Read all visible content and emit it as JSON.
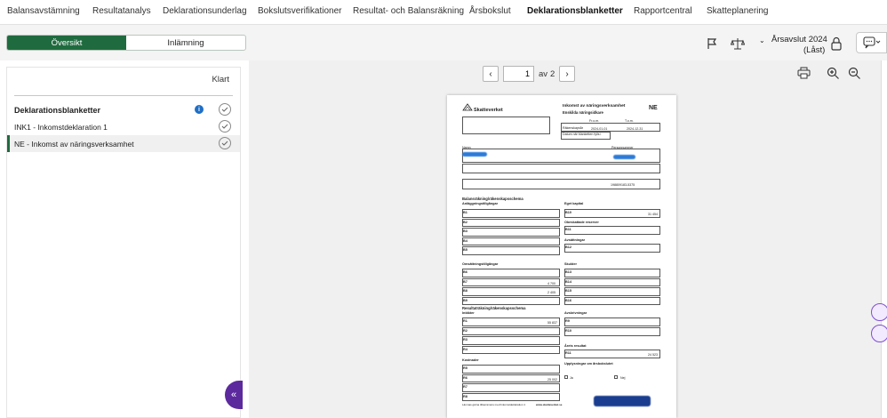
{
  "topnav": {
    "items": [
      "Balansavstämning",
      "Resultatanalys",
      "Deklarationsunderlag",
      "Bokslutsverifikationer",
      "Resultat- och Balansräkning",
      "Årsbokslut",
      "Deklarationsblanketter",
      "Rapportcentral",
      "Skatteplanering"
    ],
    "active_index": 6
  },
  "tabs": {
    "overview": "Översikt",
    "submission": "Inlämning",
    "active": "Översikt"
  },
  "year": {
    "line1": "Årsavslut 2024",
    "line2": "(Låst)"
  },
  "left": {
    "done_label": "Klart",
    "section_title": "Deklarationsblanketter",
    "items": [
      {
        "label": "INK1 - Inkomstdeklaration 1",
        "done": true
      },
      {
        "label": "NE - Inkomst av näringsverksamhet",
        "done": true,
        "selected": true
      }
    ]
  },
  "pager": {
    "current": "1",
    "of_label": "av",
    "total": "2"
  },
  "doc": {
    "agency": "Skatteverket",
    "title1": "Inkomst av näringsverksamhet",
    "title2": "Enskilda näringsidkare",
    "code": "NE",
    "fm": "Fr.o.m.",
    "tm": "T.o.m.",
    "period_label": "Räkenskapsår",
    "from": "2024-01-01",
    "to": "2024-12-31",
    "date_label": "Datum när blanketten fylls i",
    "name_label": "Namn",
    "pnr_label": "Personnummer",
    "pnr": "198809183-5375",
    "section1": "Balansräkning/räkenskapsschema",
    "assets": "Anläggningstillgångar",
    "equity": "Eget kapital",
    "untaxed": "Obeskattade reserver",
    "provisions": "Avsättningar",
    "current_assets": "Omsättningstillgångar",
    "debts": "Skulder",
    "section2": "Resultaträkning/räkenskapsschema",
    "income": "Intäkter",
    "depreciation": "Avskrivningar",
    "result": "Årets resultat",
    "costs": "Kostnader",
    "info": "Upplysningar om årsbokslutet",
    "website": "www.skatteverket.se",
    "footer": "Lämnas gärna tillsammans med Inkomstdeklaration 1",
    "ja": "Ja",
    "nej": "Nej",
    "rows_left1": [
      "B1",
      "B2",
      "B3",
      "B4",
      "B5"
    ],
    "rows_right1": [
      "B10",
      "B11",
      "B12"
    ],
    "rows_left2": [
      "B6",
      "B7",
      "B8",
      "B9"
    ],
    "rows_right2": [
      "B13",
      "B14",
      "B15",
      "B16"
    ],
    "rows_left3": [
      "R1",
      "R2",
      "R3",
      "R4"
    ],
    "rows_right3": [
      "R9",
      "R10",
      "R11"
    ],
    "rows_left4": [
      "R5",
      "R6",
      "R7",
      "R8"
    ],
    "values": {
      "b10": "31 454",
      "b7": "4 700",
      "b8": "2 405",
      "r1": "55 837",
      "r6": "25 002",
      "r11": "24 523"
    }
  }
}
